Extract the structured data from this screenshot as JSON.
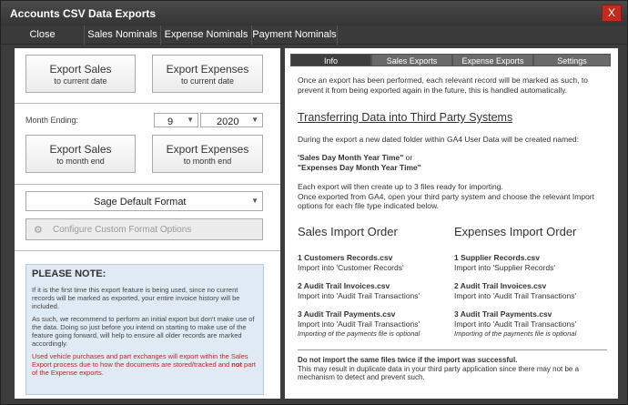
{
  "window": {
    "title": "Accounts CSV Data Exports",
    "close_label": "X"
  },
  "menu": [
    {
      "label": "Close"
    },
    {
      "label": "Sales Nominals"
    },
    {
      "label": "Expense Nominals"
    },
    {
      "label": "Payment Nominals"
    }
  ],
  "left": {
    "export_sales_current": {
      "l1": "Export Sales",
      "l2": "to current date"
    },
    "export_expenses_current": {
      "l1": "Export Expenses",
      "l2": "to current date"
    },
    "month_ending_label": "Month Ending:",
    "month_value": "9",
    "year_value": "2020",
    "export_sales_month": {
      "l1": "Export Sales",
      "l2": "to month end"
    },
    "export_expenses_month": {
      "l1": "Export Expenses",
      "l2": "to month end"
    },
    "format_value": "Sage Default Format",
    "configure_label": "Configure Custom Format Options",
    "note": {
      "title": "PLEASE NOTE:",
      "p1": "If it is the first time this export feature is being used, since no current records will be marked as exported, your entire invoice history will be included.",
      "p2": "As such, we recommend to perform an initial export but don't make use of the data.  Doing so just before you intend on starting to make use of the feature going forward, will help to ensure all older records are marked accordingly.",
      "p3a": "Used vehicle purchases and part exchanges will export within the Sales Export process due to how the documents are stored/tracked and ",
      "p3b": "not",
      "p3c": " part of the Expense exports."
    }
  },
  "right": {
    "tabs": [
      {
        "label": "Info"
      },
      {
        "label": "Sales Exports"
      },
      {
        "label": "Expense Exports"
      },
      {
        "label": "Settings"
      }
    ],
    "intro": "Once an export has been performed, each relevant record will be marked as such, to prevent it from being exported again in the future, this is handled automatically.",
    "heading1": "Transferring Data into Third Party Systems",
    "folder_text": "During the export a new dated folder within GA4 User Data will be created named:",
    "folder_name1": "'Sales Day Month Year Time\"",
    "folder_or": "  or",
    "folder_name2": "\"Expenses Day Month Year Time\"",
    "files_text": "Each export will then create up to 3 files ready for importing.\nOnce exported from GA4, open your third party system and choose the relevant Import options for each file type indicated below.",
    "sales_heading": "Sales Import Order",
    "expenses_heading": "Expenses Import Order",
    "sales_items": [
      {
        "file": "1 Customers Records.csv",
        "desc": "Import into 'Customer Records'"
      },
      {
        "file": "2 Audit Trail Invoices.csv",
        "desc": "Import into 'Audit Trail Transactions'"
      },
      {
        "file": "3 Audit Trail Payments.csv",
        "desc": "Import into 'Audit Trail Transactions'",
        "note": "Importing of the payments file is optional"
      }
    ],
    "expense_items": [
      {
        "file": "1 Supplier Records.csv",
        "desc": "Import into 'Supplier Records'"
      },
      {
        "file": "2 Audit Trail Invoices.csv",
        "desc": "Import into 'Audit Trail Transactions'"
      },
      {
        "file": "3 Audit Trail Payments.csv",
        "desc": "Import into 'Audit Trail Transactions'",
        "note": "Importing of the payments file is optional"
      }
    ],
    "warning_bold": "Do not import the same files twice if the import was successful.",
    "warning_text": "This may result in duplicate data in your third party application since there may not be a mechanism to detect and prevent such."
  }
}
